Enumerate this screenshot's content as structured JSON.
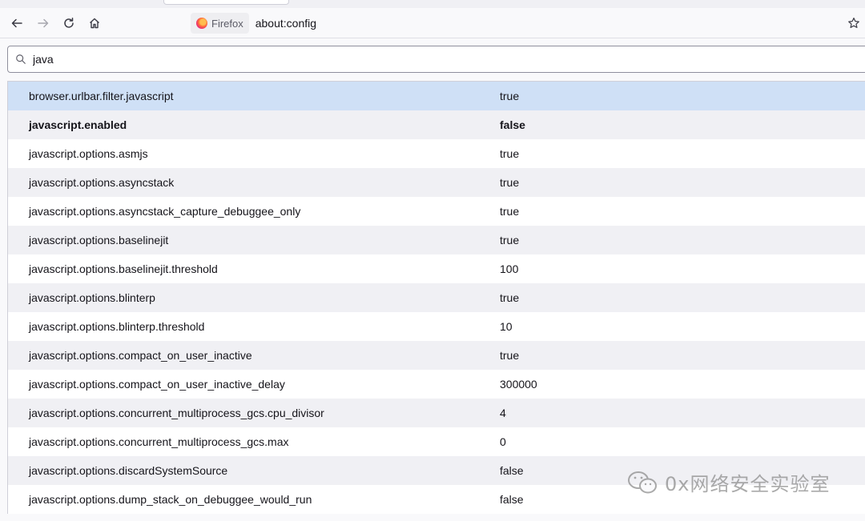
{
  "browser": {
    "identity_label": "Firefox",
    "url": "about:config",
    "icons": [
      "back-icon",
      "forward-icon",
      "reload-icon",
      "home-icon",
      "bookmark-star-icon"
    ]
  },
  "search": {
    "value": "java"
  },
  "prefs": [
    {
      "name": "browser.urlbar.filter.javascript",
      "value": "true"
    },
    {
      "name": "javascript.enabled",
      "value": "false"
    },
    {
      "name": "javascript.options.asmjs",
      "value": "true"
    },
    {
      "name": "javascript.options.asyncstack",
      "value": "true"
    },
    {
      "name": "javascript.options.asyncstack_capture_debuggee_only",
      "value": "true"
    },
    {
      "name": "javascript.options.baselinejit",
      "value": "true"
    },
    {
      "name": "javascript.options.baselinejit.threshold",
      "value": "100"
    },
    {
      "name": "javascript.options.blinterp",
      "value": "true"
    },
    {
      "name": "javascript.options.blinterp.threshold",
      "value": "10"
    },
    {
      "name": "javascript.options.compact_on_user_inactive",
      "value": "true"
    },
    {
      "name": "javascript.options.compact_on_user_inactive_delay",
      "value": "300000"
    },
    {
      "name": "javascript.options.concurrent_multiprocess_gcs.cpu_divisor",
      "value": "4"
    },
    {
      "name": "javascript.options.concurrent_multiprocess_gcs.max",
      "value": "0"
    },
    {
      "name": "javascript.options.discardSystemSource",
      "value": "false"
    },
    {
      "name": "javascript.options.dump_stack_on_debuggee_would_run",
      "value": "false"
    }
  ],
  "watermark": {
    "text": "0x网络安全实验室"
  },
  "colors": {
    "selected_row": "#cfe0f6",
    "alt_row": "#f0f0f4"
  }
}
